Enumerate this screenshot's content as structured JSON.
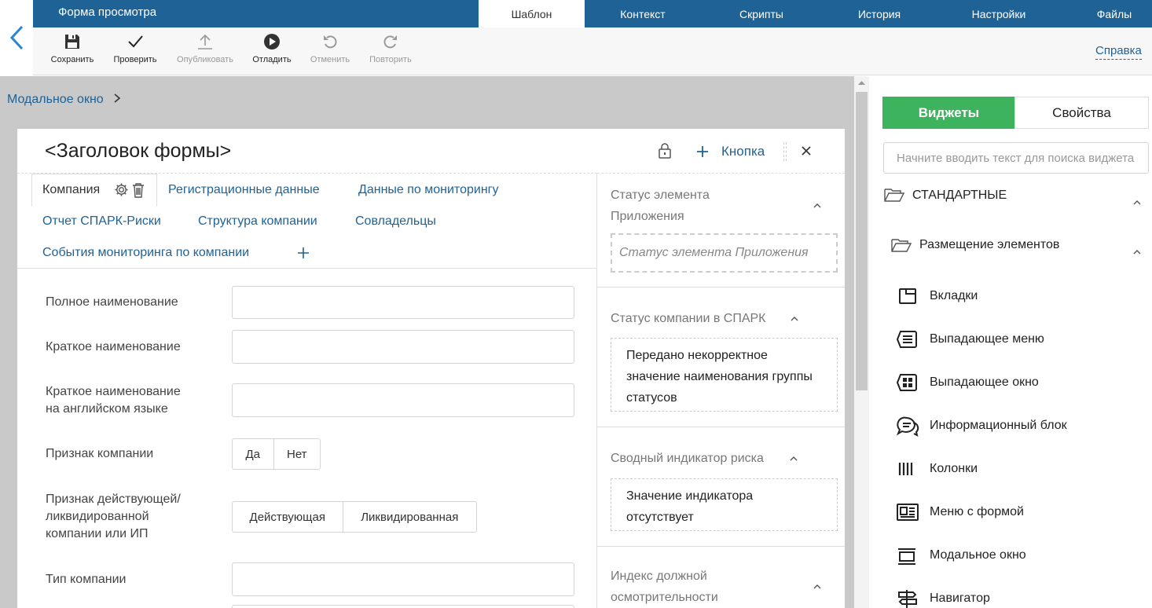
{
  "header": {
    "title": "Форма просмотра",
    "tabs": [
      {
        "label": "Шаблон",
        "active": true
      },
      {
        "label": "Контекст"
      },
      {
        "label": "Скрипты"
      },
      {
        "label": "История"
      },
      {
        "label": "Настройки"
      },
      {
        "label": "Файлы"
      }
    ]
  },
  "toolbar": {
    "items": [
      {
        "label": "Сохранить",
        "icon": "save-icon",
        "enabled": true
      },
      {
        "label": "Проверить",
        "icon": "check-icon",
        "enabled": true
      },
      {
        "label": "Опубликовать",
        "icon": "upload-icon",
        "enabled": false
      },
      {
        "label": "Отладить",
        "icon": "play-icon",
        "enabled": true
      },
      {
        "label": "Отменить",
        "icon": "undo-icon",
        "enabled": false
      },
      {
        "label": "Повторить",
        "icon": "redo-icon",
        "enabled": false
      }
    ],
    "help": "Справка"
  },
  "breadcrumb": {
    "label": "Модальное окно"
  },
  "form": {
    "title": "<Заголовок формы>",
    "button_label": "Кнопка",
    "tabs": [
      "Компания",
      "Регистрационные данные",
      "Данные по мониторингу",
      "Отчет СПАРК-Риски",
      "Структура компании",
      "Совладельцы",
      "События мониторинга по компании"
    ],
    "fields": {
      "full_name": "Полное наименование",
      "short_name": "Краткое наименование",
      "short_name_en_1": "Краткое наименование",
      "short_name_en_2": "на английском языке",
      "company_sign": "Признак компании",
      "active_sign_1": "Признак действующей/",
      "active_sign_2": "ликвидированной",
      "active_sign_3": "компании или ИП",
      "company_type": "Тип компании"
    },
    "toggles": {
      "yes": "Да",
      "no": "Нет",
      "active": "Действующая",
      "liquidated": "Ликвидированная"
    },
    "side": {
      "status_app_title_1": "Статус элемента",
      "status_app_title_2": "Приложения",
      "status_app_placeholder": "Статус элемента Приложения",
      "spark_status_title": "Статус компании в СПАРК",
      "spark_status_text_1": "Передано некорректное",
      "spark_status_text_2": "значение наименования группы",
      "spark_status_text_3": "статусов",
      "risk_title": "Сводный индикатор риска",
      "risk_text_1": "Значение индикатора",
      "risk_text_2": "отсутствует",
      "due_title_1": "Индекс должной",
      "due_title_2": "осмотрительности"
    }
  },
  "panel": {
    "tab_widgets": "Виджеты",
    "tab_props": "Свойства",
    "search_placeholder": "Начните вводить текст для поиска виджета",
    "group": "СТАНДАРТНЫЕ",
    "subgroup": "Размещение элементов",
    "items": [
      {
        "label": "Вкладки",
        "icon": "tabs-icon"
      },
      {
        "label": "Выпадающее меню",
        "icon": "dropdown-menu-icon"
      },
      {
        "label": "Выпадающее окно",
        "icon": "dropdown-window-icon"
      },
      {
        "label": "Информационный блок",
        "icon": "info-block-icon"
      },
      {
        "label": "Колонки",
        "icon": "columns-icon"
      },
      {
        "label": "Меню с формой",
        "icon": "form-menu-icon"
      },
      {
        "label": "Модальное окно",
        "icon": "modal-window-icon"
      },
      {
        "label": "Навигатор",
        "icon": "navigator-icon"
      }
    ]
  },
  "colors": {
    "brand": "#1f6295",
    "active_widget_tab": "#3db35d"
  }
}
